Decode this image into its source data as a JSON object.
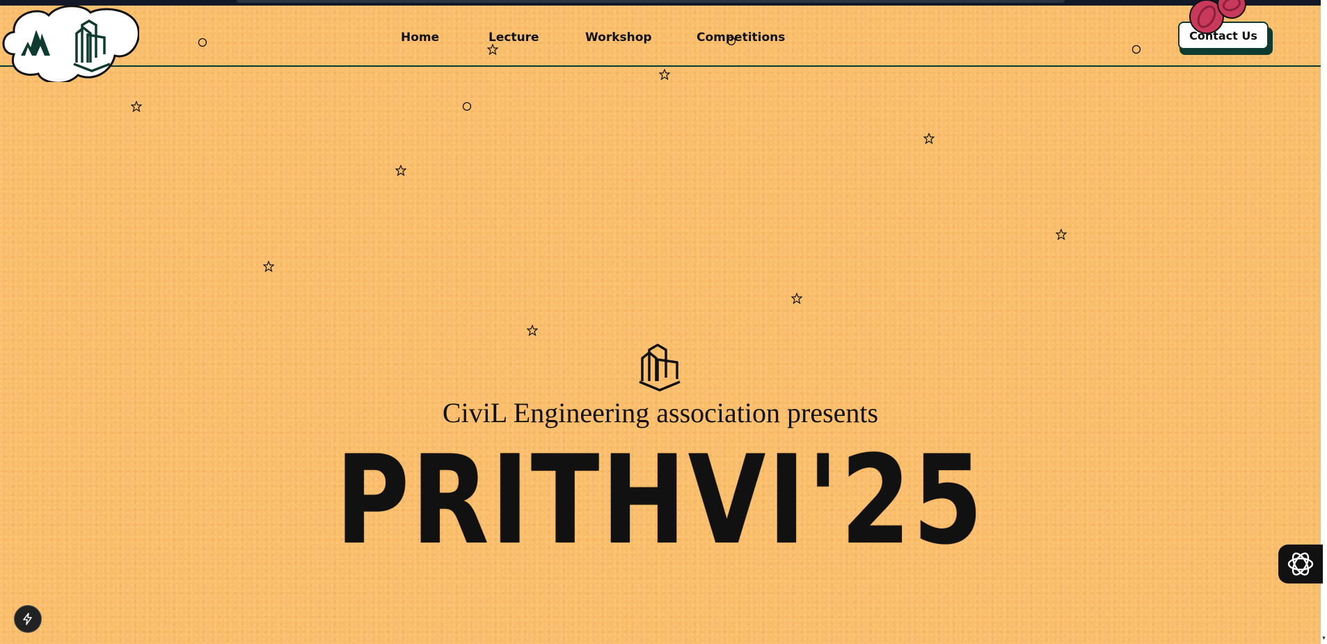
{
  "nav": {
    "links": [
      {
        "label": "Home"
      },
      {
        "label": "Lecture"
      },
      {
        "label": "Workshop"
      },
      {
        "label": "Competitions"
      }
    ],
    "contact_label": "Contact Us"
  },
  "hero": {
    "subtitle": "CiviL Engineering association presents",
    "title": "PRITHVI'25"
  },
  "icons": {
    "logo": "building-logo-icon",
    "hero": "building-logo-icon",
    "side_widget": "hexagon-flower-icon",
    "bolt": "lightning-bolt-icon"
  },
  "colors": {
    "background": "#f9bd6c",
    "accent": "#0e3b2f",
    "text": "#111111",
    "planet": "#c9395b"
  }
}
